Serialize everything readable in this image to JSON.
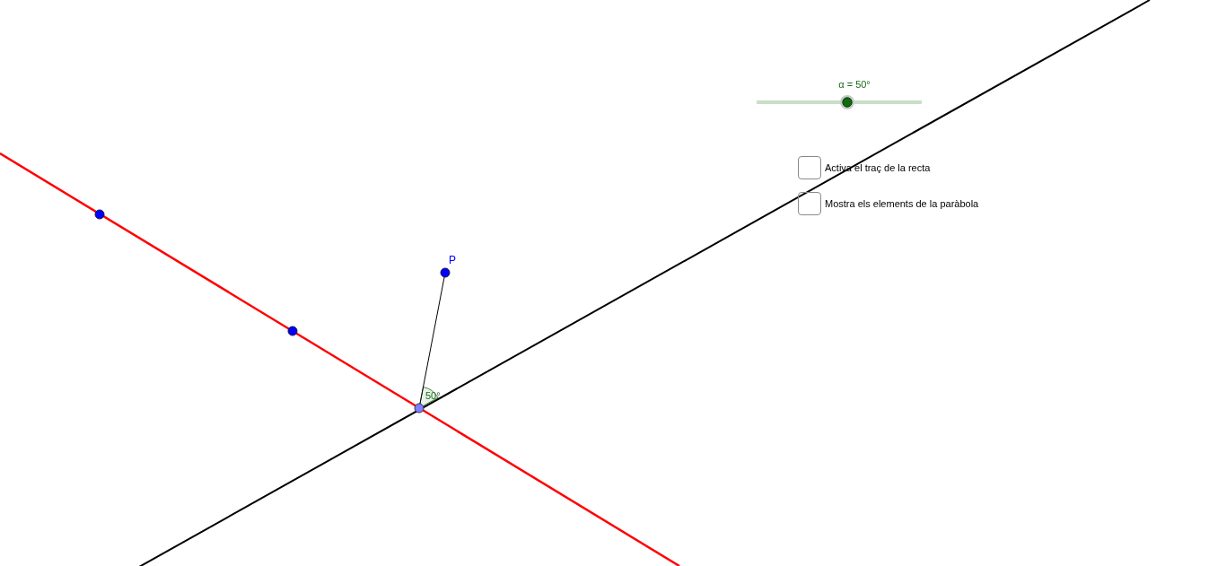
{
  "slider": {
    "label": "α = 50°",
    "level": 0.55
  },
  "checkboxes": [
    {
      "label": "Activa el traç de la recta",
      "checked": false
    },
    {
      "label": "Mostra els elements de la paràbola",
      "checked": false
    }
  ],
  "canvas": {
    "point_label": "P",
    "angle_label": "50°"
  }
}
